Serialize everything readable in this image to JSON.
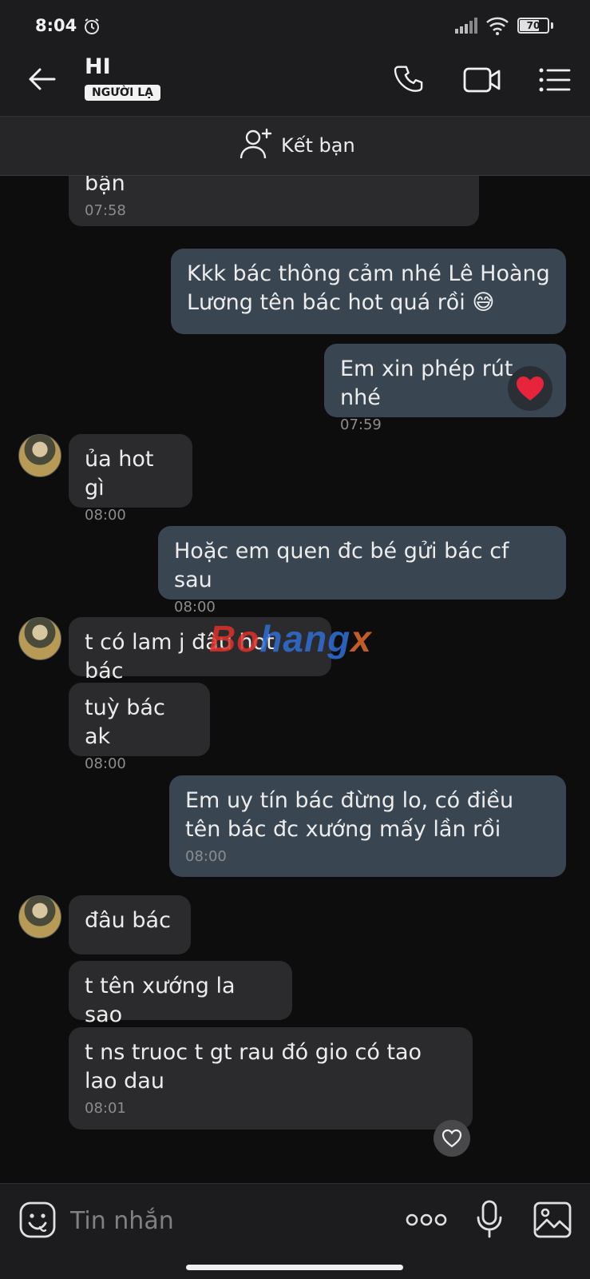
{
  "status_bar": {
    "time": "8:04",
    "battery": "70",
    "battery_level": 0.7,
    "icons": [
      "alarm-icon",
      "signal-icon",
      "wifi-icon",
      "battery-icon"
    ]
  },
  "header": {
    "name": "HI",
    "badge": "NGƯỜI LẠ",
    "icons": [
      "back-arrow-icon",
      "phone-call-icon",
      "video-call-icon",
      "menu-list-icon"
    ]
  },
  "add_friend": {
    "label": "Kết bạn",
    "icon": "add-user-icon"
  },
  "messages": [
    {
      "dir": "in",
      "text": "bận",
      "time": "07:58"
    },
    {
      "dir": "out",
      "text": "Kkk bác thông cảm nhé Lê Hoàng Lương tên bác hot quá rồi 😅",
      "time": ""
    },
    {
      "dir": "out",
      "text": "Em xin phép rút nhé",
      "time": "07:59",
      "reaction": "❤️"
    },
    {
      "dir": "in",
      "text": "ủa hot gì",
      "time": "08:00"
    },
    {
      "dir": "out",
      "text": "Hoặc em quen đc bé gửi bác cf sau",
      "time": "08:00"
    },
    {
      "dir": "in",
      "text": "t có lam j đâu hot bác",
      "time": ""
    },
    {
      "dir": "in",
      "text": "tuỳ bác ak",
      "time": "08:00"
    },
    {
      "dir": "out",
      "text": "Em uy tín bác đừng lo, có điều tên bác đc xướng mấy lần rồi",
      "time": "08:00"
    },
    {
      "dir": "in",
      "text": "đâu bác",
      "time": ""
    },
    {
      "dir": "in",
      "text": "t tên xướng la sao",
      "time": ""
    },
    {
      "dir": "in",
      "text": "t ns truoc t gt rau đó gio có tao lao dau",
      "time": "08:01"
    }
  ],
  "watermark": {
    "part1": "Bo",
    "part2": "hang",
    "part3": "x"
  },
  "input_bar": {
    "placeholder": "Tin nhắn",
    "icons": [
      "sticker-icon",
      "more-options-icon",
      "microphone-icon",
      "image-gallery-icon"
    ]
  },
  "colors": {
    "background": "#0d0d0e",
    "bar": "#1c1c1e",
    "incoming_bubble": "#2b2b2d",
    "outgoing_bubble": "#3a4552",
    "watermark_red": "#e0302a",
    "watermark_blue": "#2f6fd6",
    "heart": "#e8243c"
  }
}
